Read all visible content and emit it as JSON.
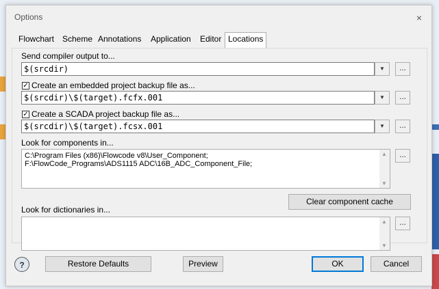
{
  "dialog": {
    "title": "Options",
    "close_icon": "×"
  },
  "tabs": [
    "Flowchart",
    "Scheme",
    "Annotations",
    "Application",
    "Editor",
    "Locations"
  ],
  "active_tab": "Locations",
  "compiler_output": {
    "label": "Send compiler output to...",
    "value": "$(srcdir)",
    "dropdown_icon": "▼",
    "browse_label": "..."
  },
  "embedded_backup": {
    "checked": true,
    "check_mark": "✓",
    "label": "Create an embedded project backup file as...",
    "value": "$(srcdir)\\$(target).fcfx.001",
    "dropdown_icon": "▼",
    "browse_label": "..."
  },
  "scada_backup": {
    "checked": true,
    "check_mark": "✓",
    "label": "Create a SCADA project backup file as...",
    "value": "$(srcdir)\\$(target).fcsx.001",
    "dropdown_icon": "▼",
    "browse_label": "..."
  },
  "components": {
    "label": "Look for components in...",
    "value": "C:\\Program Files (x86)\\Flowcode v8\\User_Component;\nF:\\FlowCode_Programs\\ADS1115 ADC\\16B_ADC_Component_File;",
    "browse_label": "...",
    "scroll_up": "▲",
    "scroll_down": "▼"
  },
  "clear_cache_label": "Clear component cache",
  "dictionaries": {
    "label": "Look for dictionaries in...",
    "value": "",
    "browse_label": "...",
    "scroll_up": "▲",
    "scroll_down": "▼"
  },
  "footer": {
    "help_icon": "?",
    "restore_label": "Restore Defaults",
    "preview_label": "Preview",
    "ok_label": "OK",
    "cancel_label": "Cancel"
  }
}
